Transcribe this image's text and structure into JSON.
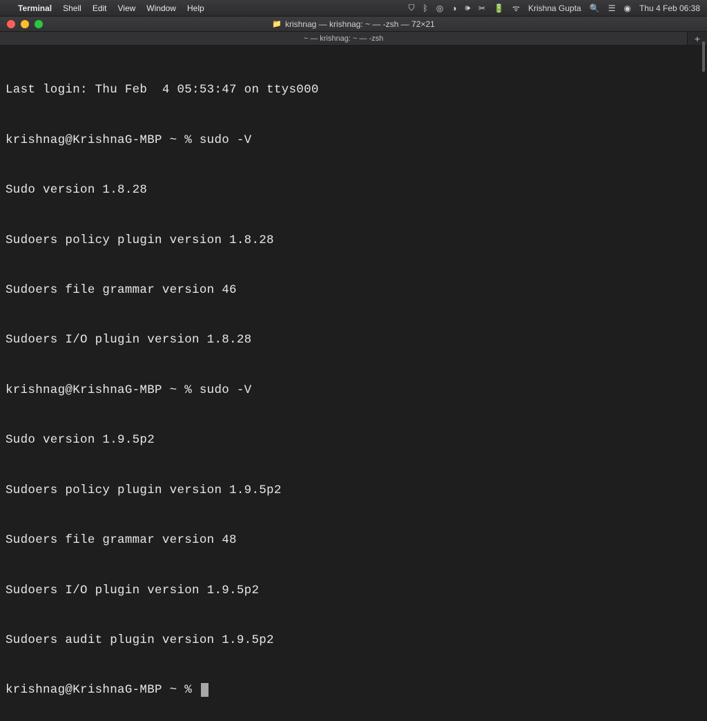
{
  "menubar": {
    "app": "Terminal",
    "items": [
      "Shell",
      "Edit",
      "View",
      "Window",
      "Help"
    ],
    "user": "Krishna Gupta",
    "datetime": "Thu 4 Feb  06:38"
  },
  "window": {
    "title": "krishnag — krishnag: ~ — -zsh — 72×21"
  },
  "tab": {
    "label": "~ — krishnag: ~ — -zsh"
  },
  "terminal": {
    "lines": [
      "Last login: Thu Feb  4 05:53:47 on ttys000",
      "krishnag@KrishnaG-MBP ~ % sudo -V",
      "Sudo version 1.8.28",
      "Sudoers policy plugin version 1.8.28",
      "Sudoers file grammar version 46",
      "Sudoers I/O plugin version 1.8.28",
      "krishnag@KrishnaG-MBP ~ % sudo -V",
      "Sudo version 1.9.5p2",
      "Sudoers policy plugin version 1.9.5p2",
      "Sudoers file grammar version 48",
      "Sudoers I/O plugin version 1.9.5p2",
      "Sudoers audit plugin version 1.9.5p2"
    ],
    "prompt": "krishnag@KrishnaG-MBP ~ % "
  },
  "status_icons": {
    "shield": "⛨",
    "bluetooth": "ᛒ",
    "circle1": "◎",
    "circle2": "◑",
    "volume": "🔊",
    "scissors": "✄",
    "battery": "🔋",
    "wifi": "ᯤ",
    "search": "🔍",
    "control": "�included",
    "siri": "◉"
  }
}
